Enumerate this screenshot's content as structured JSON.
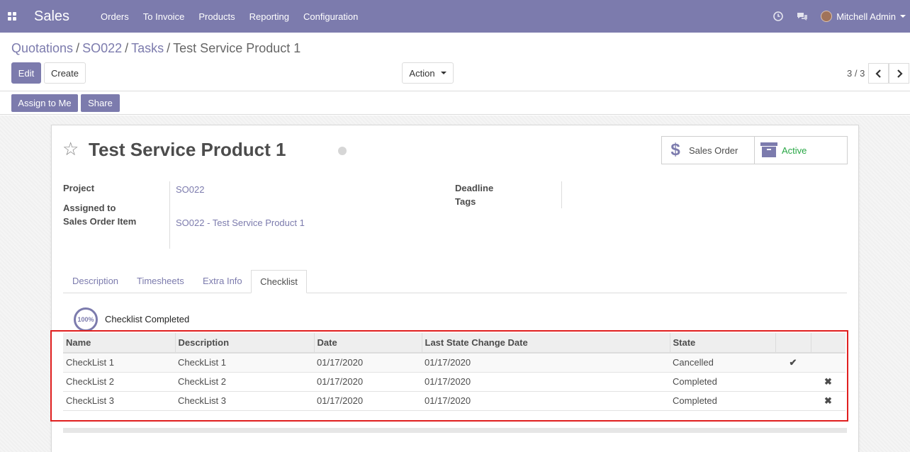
{
  "navbar": {
    "brand": "Sales",
    "menu": [
      "Orders",
      "To Invoice",
      "Products",
      "Reporting",
      "Configuration"
    ],
    "user": "Mitchell Admin"
  },
  "breadcrumb": {
    "items": [
      "Quotations",
      "SO022",
      "Tasks"
    ],
    "current": "Test Service Product 1",
    "separator": "/"
  },
  "buttons": {
    "edit": "Edit",
    "create": "Create",
    "action": "Action"
  },
  "pager": {
    "value": "3 / 3"
  },
  "statusbar": {
    "assign": "Assign to Me",
    "share": "Share"
  },
  "record": {
    "title": "Test Service Product 1",
    "smart_buttons": {
      "sales_order": "Sales Order",
      "active": "Active"
    },
    "fields": {
      "project_label": "Project",
      "project_value": "SO022",
      "assigned_label": "Assigned to",
      "sol_label": "Sales Order Item",
      "sol_value": "SO022 - Test Service Product 1",
      "deadline_label": "Deadline",
      "tags_label": "Tags"
    }
  },
  "tabs": [
    "Description",
    "Timesheets",
    "Extra Info",
    "Checklist"
  ],
  "checklist": {
    "progress": "100%",
    "label": "Checklist Completed",
    "columns": [
      "Name",
      "Description",
      "Date",
      "Last State Change Date",
      "State"
    ],
    "rows": [
      {
        "name": "CheckList 1",
        "description": "CheckList 1",
        "date": "01/17/2020",
        "last_change": "01/17/2020",
        "state": "Cancelled",
        "approve": "✔",
        "reject": ""
      },
      {
        "name": "CheckList 2",
        "description": "CheckList 2",
        "date": "01/17/2020",
        "last_change": "01/17/2020",
        "state": "Completed",
        "approve": "",
        "reject": "✖"
      },
      {
        "name": "CheckList 3",
        "description": "CheckList 3",
        "date": "01/17/2020",
        "last_change": "01/17/2020",
        "state": "Completed",
        "approve": "",
        "reject": "✖"
      }
    ]
  },
  "colors": {
    "primary": "#7c7bad",
    "active": "#28a745",
    "highlight": "#e01f1f"
  }
}
